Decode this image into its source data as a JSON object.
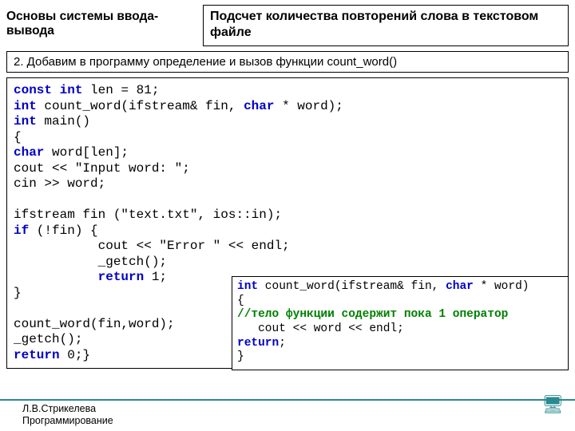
{
  "header": {
    "doc_title": "Основы системы ввода-вывода",
    "title_box": "Подсчет количества повторений слова в текстовом файле"
  },
  "step_box": "2. Добавим в программу определение и вызов функции count_word()",
  "code": {
    "kw_const": "const",
    "kw_int": "int",
    "kw_char": "char",
    "kw_return": "return",
    "kw_if": "if",
    "l1a": " len = 81;",
    "l2a": " count_word(ifstream& fin, ",
    "l2b": " * word);",
    "l3a": " main()",
    "l4": "{",
    "l5a": " word[len];",
    "l6": "cout << \"Input word: \";",
    "l7": "cin >> word;",
    "l9": "ifstream fin (\"text.txt\", ios::in);",
    "l10a": " (!fin) {",
    "l11": "           cout << \"Error \" << endl;",
    "l12": "           _getch();",
    "l13a": "           ",
    "l13b": " 1;",
    "l14": "}",
    "l16": "count_word(fin,word);",
    "l17": "_getch();",
    "l18a": " 0;}"
  },
  "inner": {
    "l1a": " count_word(ifstream& fin, ",
    "l1b": " * word)",
    "l2": "{",
    "l3": "//тело функции содержит пока 1 оператор",
    "l4": "   cout << word << endl;",
    "l5": ";",
    "l6": "}"
  },
  "footer": {
    "author": "Л.В.Стрикелева",
    "course": "Программирование"
  }
}
